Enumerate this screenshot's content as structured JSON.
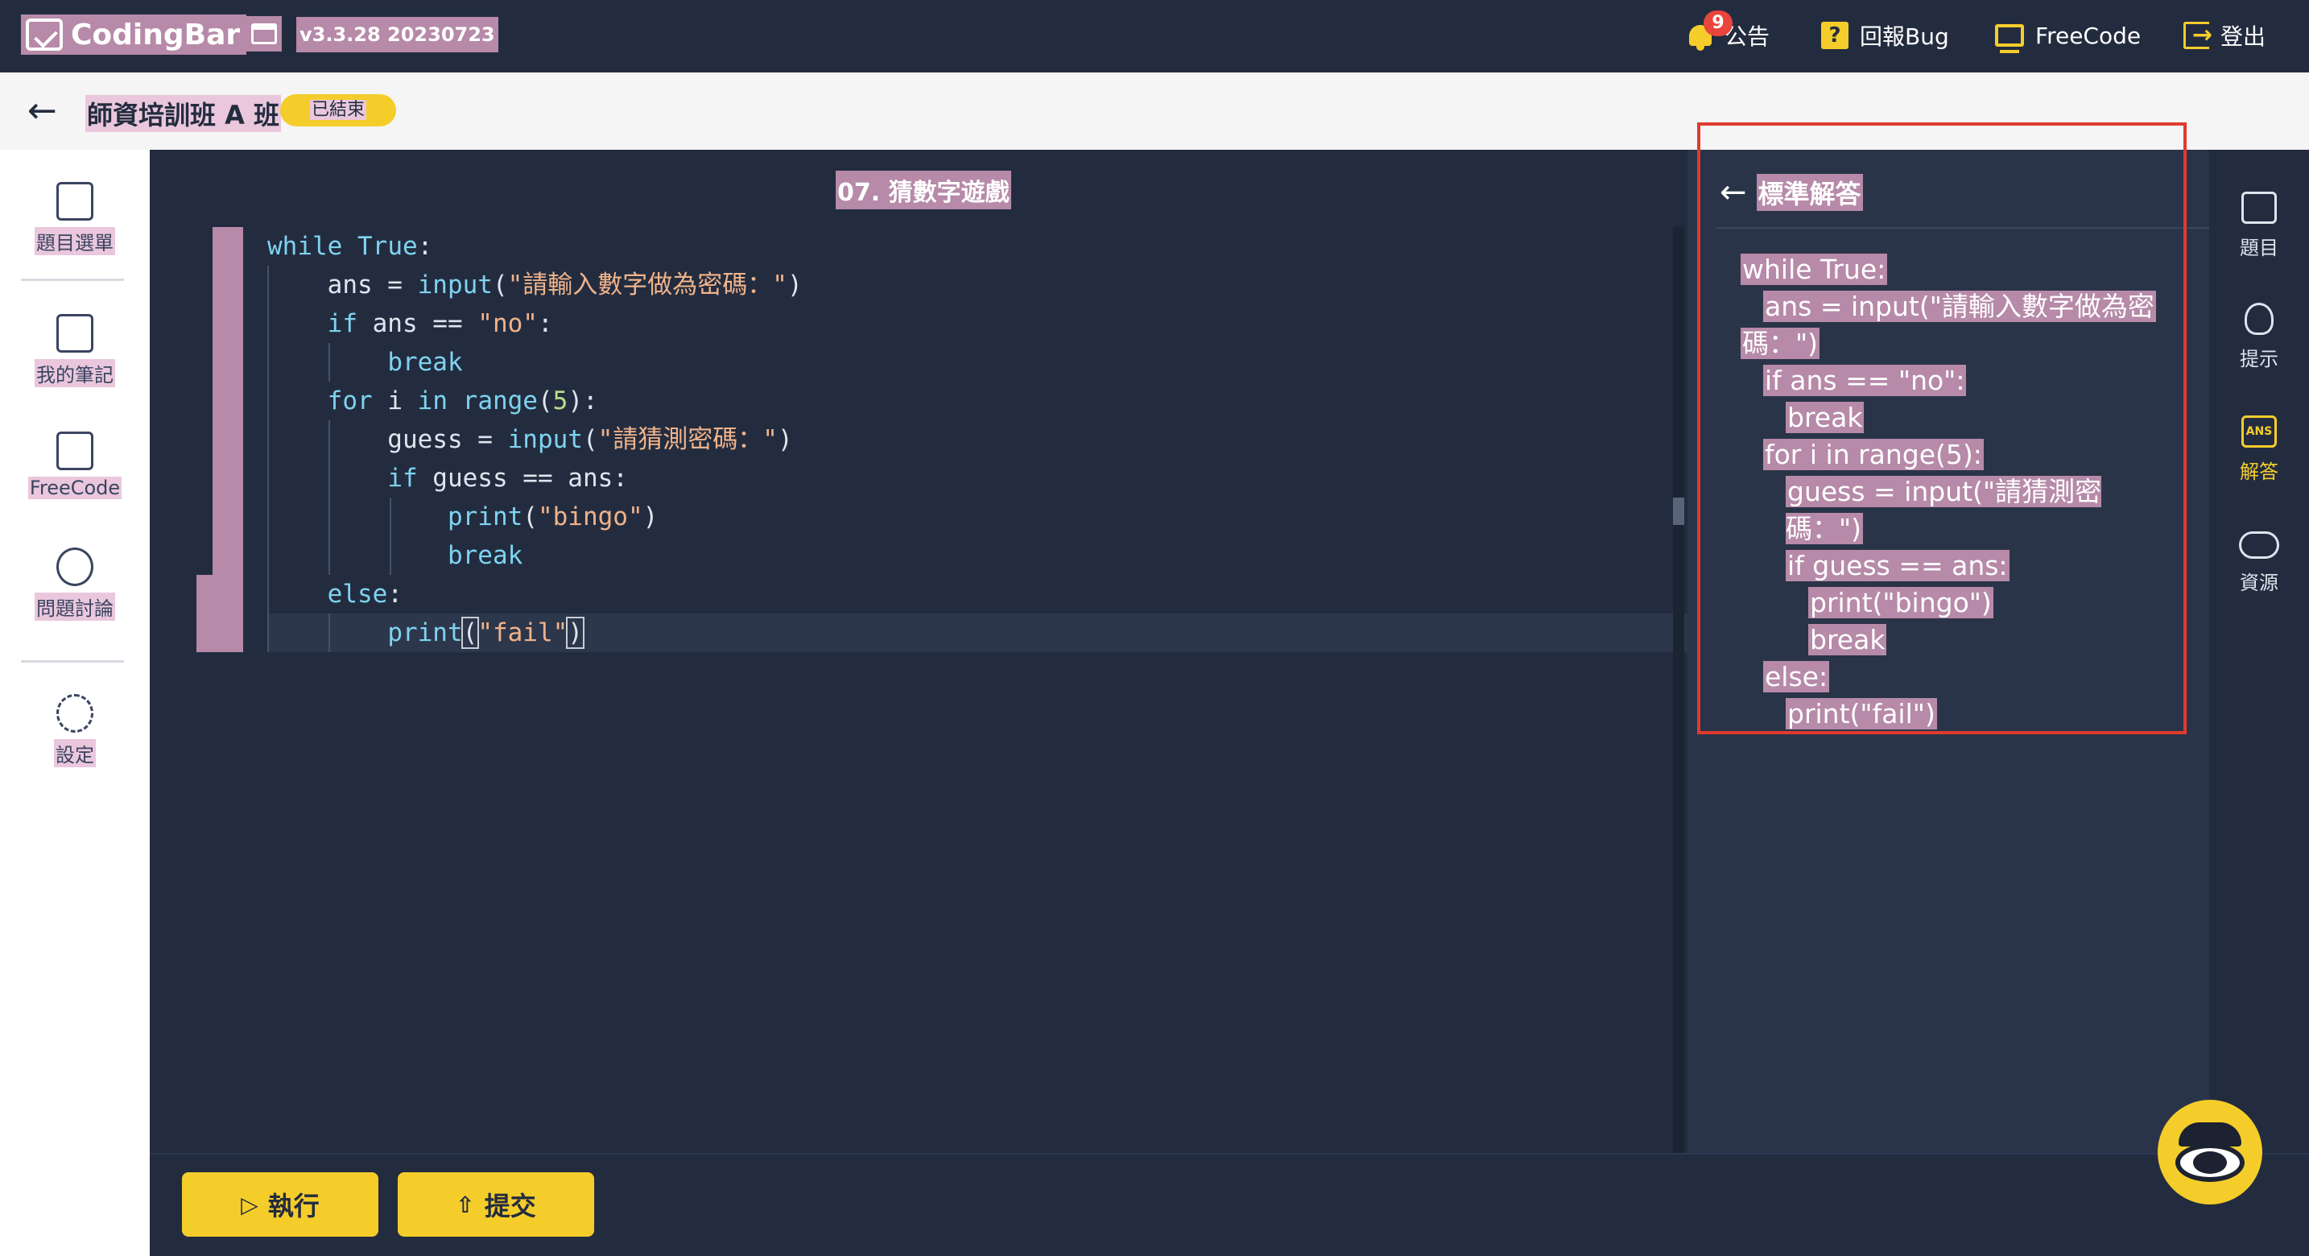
{
  "topbar": {
    "logo_text": "CodingBar",
    "version": "v3.3.28 20230723",
    "notification_count": "9",
    "announcement_label": "公告",
    "bug_report_label": "回報Bug",
    "freecode_label": "FreeCode",
    "logout_label": "登出"
  },
  "subheader": {
    "class_name": "師資培訓班 A 班",
    "status": "已結束"
  },
  "left_sidebar": {
    "items": [
      {
        "label": "題目選單",
        "icon": "list-icon"
      },
      {
        "label": "我的筆記",
        "icon": "note-icon"
      },
      {
        "label": "FreeCode",
        "icon": "code-icon"
      },
      {
        "label": "問題討論",
        "icon": "chat-icon"
      },
      {
        "label": "設定",
        "icon": "gear-icon"
      }
    ]
  },
  "editor": {
    "title": "07. 猜數字遊戲",
    "lines": [
      "while True:",
      "    ans = input(\"請輸入數字做為密碼：\")",
      "    if ans == \"no\":",
      "        break",
      "    for i in range(5):",
      "        guess = input(\"請猜測密碼：\")",
      "        if guess == ans:",
      "            print(\"bingo\")",
      "            break",
      "    else:",
      "        print(\"fail\")"
    ]
  },
  "actions": {
    "run_label": "執行",
    "submit_label": "提交"
  },
  "answer_panel": {
    "title": "標準解答",
    "lines": [
      "while True:",
      "ans = input(\"請輸入數字做為密",
      "碼：\")",
      "if ans == \"no\":",
      "break",
      "for i in range(5):",
      "guess = input(\"請猜測密碼：\")",
      "if guess == ans:",
      "print(\"bingo\")",
      "break",
      "else:",
      "print(\"fail\")"
    ]
  },
  "right_rail": {
    "items": [
      {
        "label": "題目",
        "icon": "cards-icon"
      },
      {
        "label": "提示",
        "icon": "lightbulb-icon"
      },
      {
        "label": "解答",
        "icon": "answer-folder-icon",
        "icon_text": "ANS"
      },
      {
        "label": "資源",
        "icon": "cloud-download-icon"
      }
    ]
  },
  "colors": {
    "topbar_bg": "#232c3f",
    "accent_yellow": "#f5cd2b",
    "highlight": "#b68aa8",
    "frame_red": "#e03a2f"
  }
}
